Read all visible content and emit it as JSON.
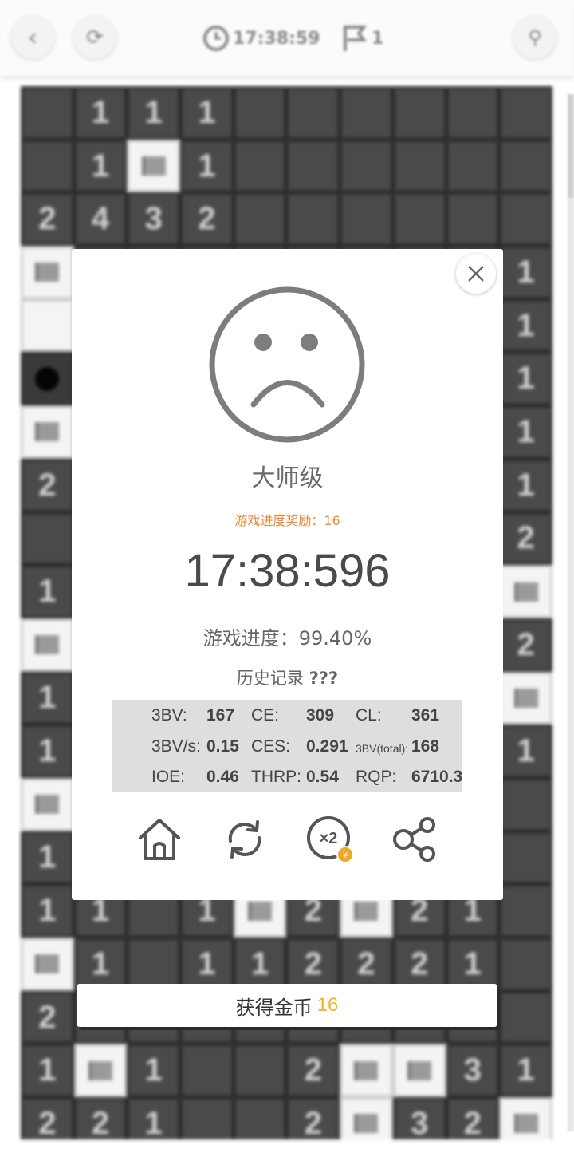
{
  "topbar": {
    "timer": "17:38:59",
    "flags": "1"
  },
  "board": {
    "columns": 10,
    "rows": [
      [
        "",
        "1",
        "1",
        "1",
        "",
        "",
        "",
        "",
        "",
        ""
      ],
      [
        "",
        "1",
        "F",
        "1",
        "",
        "",
        "",
        "",
        "",
        ""
      ],
      [
        "2",
        "4",
        "3",
        "2",
        "",
        "",
        "",
        "",
        "",
        ""
      ],
      [
        "F",
        "",
        "",
        "",
        "",
        "",
        "",
        "",
        "",
        "1"
      ],
      [
        "W",
        "",
        "",
        "",
        "",
        "",
        "",
        "",
        "",
        "1"
      ],
      [
        "M",
        "",
        "",
        "",
        "",
        "",
        "",
        "",
        "",
        "1"
      ],
      [
        "F",
        "",
        "",
        "",
        "",
        "",
        "",
        "",
        "",
        "1"
      ],
      [
        "2",
        "",
        "",
        "",
        "",
        "",
        "",
        "",
        "",
        "1"
      ],
      [
        "",
        "",
        "",
        "",
        "",
        "",
        "",
        "",
        "",
        "2"
      ],
      [
        "1",
        "",
        "",
        "",
        "",
        "",
        "",
        "",
        "",
        "F"
      ],
      [
        "F",
        "",
        "",
        "",
        "",
        "",
        "",
        "",
        "",
        "2"
      ],
      [
        "1",
        "",
        "",
        "",
        "",
        "",
        "",
        "",
        "",
        "F"
      ],
      [
        "1",
        "",
        "",
        "",
        "",
        "",
        "",
        "",
        "",
        "1"
      ],
      [
        "F",
        "",
        "",
        "",
        "",
        "",
        "",
        "",
        "",
        ""
      ],
      [
        "1",
        "",
        "",
        "",
        "",
        "",
        "",
        "",
        "",
        ""
      ],
      [
        "1",
        "1",
        "",
        "1",
        "F",
        "2",
        "F",
        "2",
        "1",
        ""
      ],
      [
        "F",
        "1",
        "",
        "1",
        "1",
        "2",
        "2",
        "2",
        "1",
        ""
      ],
      [
        "2",
        "",
        "",
        "",
        "",
        "",
        "",
        "",
        "",
        ""
      ],
      [
        "1",
        "F",
        "1",
        "",
        "",
        "2",
        "F",
        "F",
        "3",
        "1"
      ],
      [
        "2",
        "2",
        "1",
        "",
        "",
        "2",
        "F",
        "3",
        "2",
        "F"
      ]
    ]
  },
  "modal": {
    "level": "大师级",
    "reward": "游戏进度奖励：16",
    "time": "17:38:596",
    "progress": "游戏进度：99.40%",
    "history_label": "历史记录",
    "history_value": "???",
    "stats": {
      "bv_label": "3BV:",
      "bv": "167",
      "ce_label": "CE:",
      "ce": "309",
      "cl_label": "CL:",
      "cl": "361",
      "bvs_label": "3BV/s:",
      "bvs": "0.15",
      "ces_label": "CES:",
      "ces": "0.291",
      "bvtotal_label": "3BV(total):",
      "bvtotal": "168",
      "ioe_label": "IOE:",
      "ioe": "0.46",
      "thrp_label": "THRP:",
      "thrp": "0.54",
      "rqp_label": "RQP:",
      "rqp": "6710.3"
    },
    "actions": [
      "home-icon",
      "restart-icon",
      "double-coins-icon",
      "share-icon"
    ]
  },
  "coins": {
    "label": "获得金币",
    "value": "16"
  },
  "colors": {
    "reward_orange": "#ef8a3a",
    "coin_gold": "#f0b429",
    "face_gray": "#7d7d7d"
  }
}
